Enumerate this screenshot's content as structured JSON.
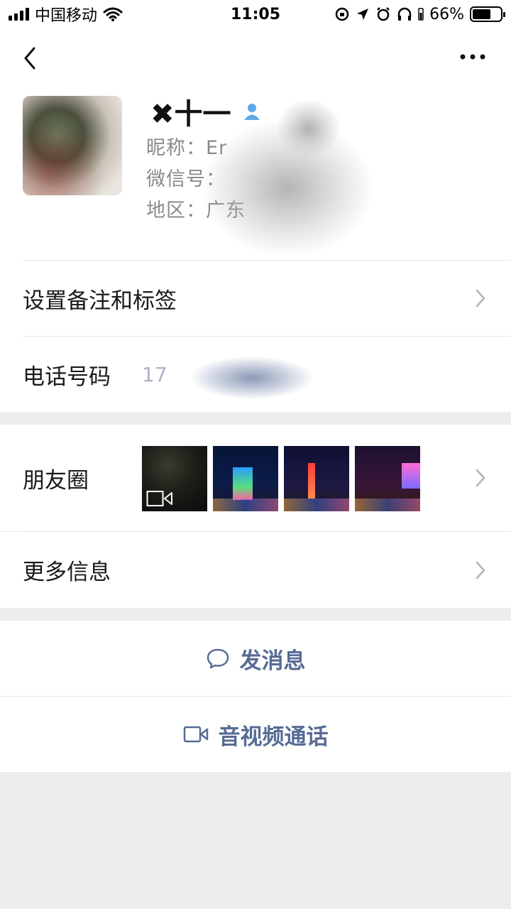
{
  "status_bar": {
    "carrier": "中国移动",
    "time": "11:05",
    "battery_percent": "66%",
    "battery_level": 0.66,
    "icons": [
      "signal-icon",
      "wifi-icon",
      "rotation-lock-icon",
      "location-icon",
      "alarm-icon",
      "headphones-icon",
      "battery-icon"
    ]
  },
  "nav": {
    "back_icon": "chevron-left-icon",
    "more_icon": "ellipsis-icon"
  },
  "profile": {
    "name": "✖十一",
    "gender_icon": "male-user-icon",
    "nickname_line": "昵称：Er",
    "wechat_id_line": "微信号：",
    "region_line": "地区：广东"
  },
  "rows": {
    "remark_label": "设置备注和标签",
    "phone_label": "电话号码",
    "phone_value": "17",
    "moments_label": "朋友圈",
    "more_info_label": "更多信息"
  },
  "actions": {
    "message_label": "发消息",
    "call_label": "音视频通话"
  },
  "colors": {
    "link_blue": "#576b95",
    "background": "#ededed"
  }
}
